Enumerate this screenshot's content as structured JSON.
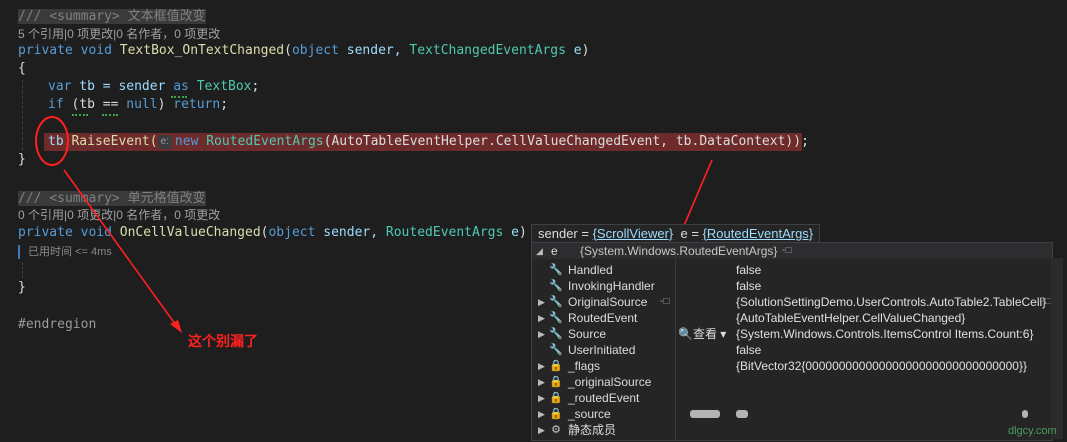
{
  "code": {
    "l1_summary": "/// <summary> 文本框值改变",
    "l2_refs": "5 个引用|0 项更改|0 名作者，0 项更改",
    "l3": {
      "kw1": "private",
      "kw2": "void",
      "method": "TextBox_OnTextChanged",
      "p1": "(",
      "kw3": "object",
      "var1": " sender, ",
      "type1": "TextChangedEventArgs",
      "var2": " e",
      ")": ")"
    },
    "l4": "{",
    "l5": {
      "kw": "var",
      "rest1": " tb = sender ",
      "kw2": "as",
      "type": "TextBox",
      ";": ";"
    },
    "l6": {
      "kw": "if",
      "rest": " (tb == ",
      "kw2": "null",
      ") ": ") ",
      "kw3": "return",
      ";": ";"
    },
    "l8": {
      "obj": "tb",
      "method": ".RaiseEvent(",
      "hint": "e:",
      "kw": "new",
      "type": "RoutedEventArgs",
      "rest": "(AutoTableEventHelper.CellValueChangedEvent, tb.DataContext));"
    },
    "l9": "}",
    "l11_summary": "/// <summary> 单元格值改变",
    "l12_refs": "0 个引用|0 项更改|0 名作者，0 项更改",
    "l13": {
      "kw1": "private",
      "kw2": "void",
      "method": "OnCellValueChanged",
      "p1": "(",
      "kw3": "object",
      "var1": " sender, ",
      "type1": "RoutedEventArgs",
      "var2": " e",
      ")": ")"
    },
    "elapsed": "已用时间 <= 4ms",
    "l16": "}",
    "l18": "#endregion"
  },
  "annotation": "这个别漏了",
  "datatip": {
    "sender_label": "sender = ",
    "sender_val": "{ScrollViewer}",
    "e_label": "  e = ",
    "e_val": "{RoutedEventArgs}"
  },
  "watch": {
    "header": {
      "name": "e",
      "value": "{System.Windows.RoutedEventArgs}"
    },
    "rows": [
      {
        "name": "Handled",
        "value": "false",
        "icon": "wrench-icon"
      },
      {
        "name": "InvokingHandler",
        "value": "false",
        "icon": "wrench-icon"
      },
      {
        "name": "OriginalSource",
        "value": "{SolutionSettingDemo.UserControls.AutoTable2.TableCell}",
        "icon": "wrench-icon"
      },
      {
        "name": "RoutedEvent",
        "value": "{AutoTableEventHelper.CellValueChanged}",
        "icon": "wrench-icon"
      },
      {
        "name": "Source",
        "value": "{System.Windows.Controls.ItemsControl Items.Count:6}",
        "icon": "wrench-icon"
      },
      {
        "name": "UserInitiated",
        "value": "false",
        "icon": "wrench-icon"
      },
      {
        "name": "_flags",
        "value": "{BitVector32{00000000000000000000000000000000}}",
        "icon": "field-lock-icon"
      },
      {
        "name": "_originalSource",
        "value": "",
        "icon": "field-lock-icon"
      },
      {
        "name": "_routedEvent",
        "value": "",
        "icon": "field-lock-icon"
      },
      {
        "name": "_source",
        "value": "",
        "icon": "field-lock-icon"
      },
      {
        "name": "静态成员",
        "value": "",
        "icon": "static-members-icon"
      }
    ],
    "look_label": "查看"
  },
  "watermark": "dlgcy.com",
  "colors": {
    "annotation": "#ff2020",
    "highlight": "#6e2b2b",
    "keyword": "#569cd6",
    "type": "#4ec9b0",
    "method": "#dcdcaa"
  }
}
